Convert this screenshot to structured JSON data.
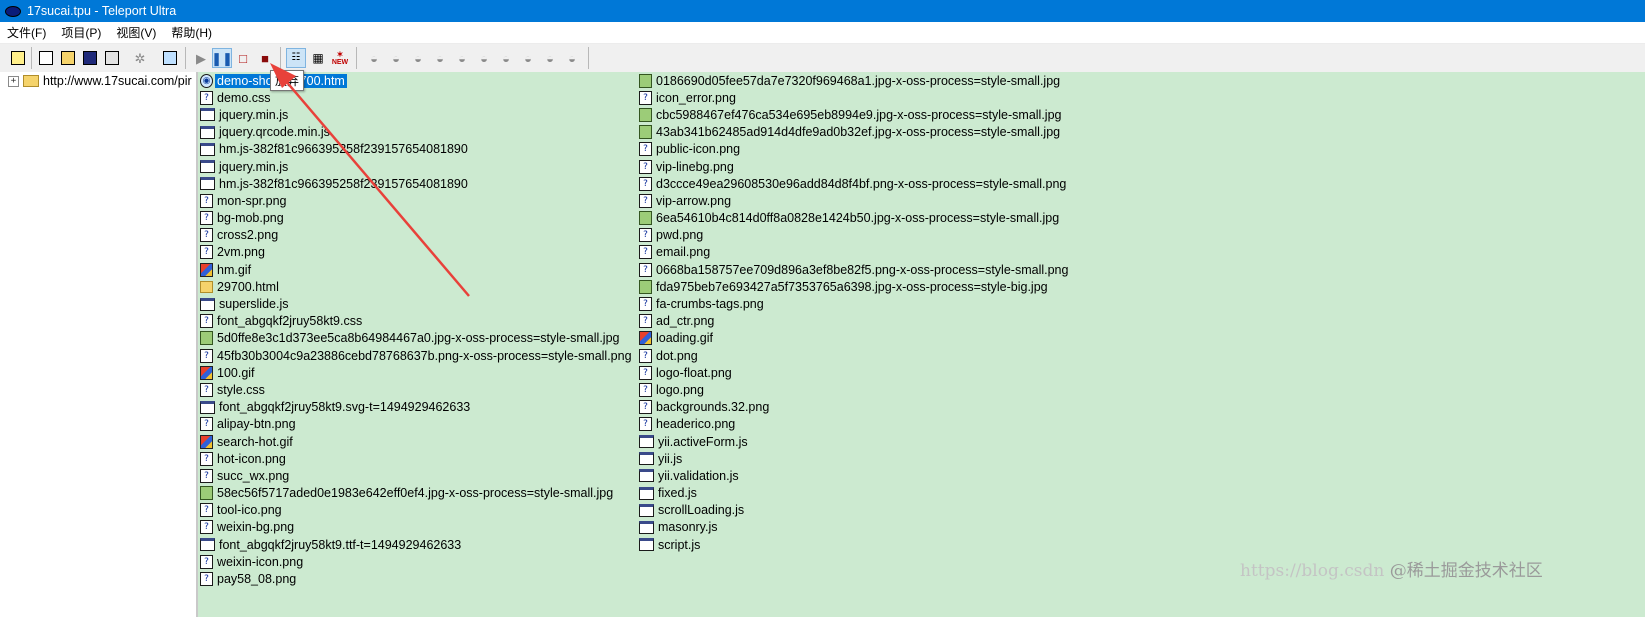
{
  "window": {
    "title": "17sucai.tpu - Teleport Ultra"
  },
  "menu": [
    "文件(F)",
    "项目(P)",
    "视图(V)",
    "帮助(H)"
  ],
  "toolbar": {
    "new_label": "NEW",
    "tooltip": "放弃"
  },
  "tree": {
    "root_label": "http://www.17sucai.com/pir"
  },
  "files": {
    "col1": [
      {
        "name": "demo-show-29700.htm",
        "icon": "html-page-icon"
      },
      {
        "name": "demo.css",
        "icon": "unknown-file-icon"
      },
      {
        "name": "jquery.min.js",
        "icon": "script-file-icon"
      },
      {
        "name": "jquery.qrcode.min.js",
        "icon": "script-file-icon"
      },
      {
        "name": "hm.js-382f81c966395258f239157654081890",
        "icon": "script-file-icon"
      },
      {
        "name": "jquery.min.js",
        "icon": "script-file-icon"
      },
      {
        "name": "hm.js-382f81c966395258f239157654081890",
        "icon": "script-file-icon"
      },
      {
        "name": "mon-spr.png",
        "icon": "unknown-file-icon"
      },
      {
        "name": "bg-mob.png",
        "icon": "unknown-file-icon"
      },
      {
        "name": "cross2.png",
        "icon": "unknown-file-icon"
      },
      {
        "name": "2vm.png",
        "icon": "unknown-file-icon"
      },
      {
        "name": "hm.gif",
        "icon": "gif-file-icon"
      },
      {
        "name": "29700.html",
        "icon": "folder-icon"
      },
      {
        "name": "superslide.js",
        "icon": "script-file-icon"
      },
      {
        "name": "font_abgqkf2jruy58kt9.css",
        "icon": "unknown-file-icon"
      },
      {
        "name": "5d0ffe8e3c1d373ee5ca8b64984467a0.jpg-x-oss-process=style-small.jpg",
        "icon": "image-file-icon"
      },
      {
        "name": "45fb30b3004c9a23886cebd78768637b.png-x-oss-process=style-small.png",
        "icon": "unknown-file-icon"
      },
      {
        "name": "100.gif",
        "icon": "gif-file-icon"
      },
      {
        "name": "style.css",
        "icon": "unknown-file-icon"
      },
      {
        "name": "font_abgqkf2jruy58kt9.svg-t=1494929462633",
        "icon": "script-file-icon"
      },
      {
        "name": "alipay-btn.png",
        "icon": "unknown-file-icon"
      },
      {
        "name": "search-hot.gif",
        "icon": "gif-file-icon"
      },
      {
        "name": "hot-icon.png",
        "icon": "unknown-file-icon"
      },
      {
        "name": "succ_wx.png",
        "icon": "unknown-file-icon"
      },
      {
        "name": "58ec56f5717aded0e1983e642eff0ef4.jpg-x-oss-process=style-small.jpg",
        "icon": "image-file-icon"
      },
      {
        "name": "tool-ico.png",
        "icon": "unknown-file-icon"
      },
      {
        "name": "weixin-bg.png",
        "icon": "unknown-file-icon"
      },
      {
        "name": "font_abgqkf2jruy58kt9.ttf-t=1494929462633",
        "icon": "script-file-icon"
      },
      {
        "name": "weixin-icon.png",
        "icon": "unknown-file-icon"
      },
      {
        "name": "pay58_08.png",
        "icon": "unknown-file-icon"
      }
    ],
    "col2": [
      {
        "name": "0186690d05fee57da7e7320f969468a1.jpg-x-oss-process=style-small.jpg",
        "icon": "image-file-icon"
      },
      {
        "name": "icon_error.png",
        "icon": "unknown-file-icon"
      },
      {
        "name": "cbc5988467ef476ca534e695eb8994e9.jpg-x-oss-process=style-small.jpg",
        "icon": "image-file-icon"
      },
      {
        "name": "43ab341b62485ad914d4dfe9ad0b32ef.jpg-x-oss-process=style-small.jpg",
        "icon": "image-file-icon"
      },
      {
        "name": "public-icon.png",
        "icon": "unknown-file-icon"
      },
      {
        "name": "vip-linebg.png",
        "icon": "unknown-file-icon"
      },
      {
        "name": "d3ccce49ea29608530e96add84d8f4bf.png-x-oss-process=style-small.png",
        "icon": "unknown-file-icon"
      },
      {
        "name": "vip-arrow.png",
        "icon": "unknown-file-icon"
      },
      {
        "name": "6ea54610b4c814d0ff8a0828e1424b50.jpg-x-oss-process=style-small.jpg",
        "icon": "image-file-icon"
      },
      {
        "name": "pwd.png",
        "icon": "unknown-file-icon"
      },
      {
        "name": "email.png",
        "icon": "unknown-file-icon"
      },
      {
        "name": "0668ba158757ee709d896a3ef8be82f5.png-x-oss-process=style-small.png",
        "icon": "unknown-file-icon"
      },
      {
        "name": "fda975beb7e693427a5f7353765a6398.jpg-x-oss-process=style-big.jpg",
        "icon": "image-file-icon"
      },
      {
        "name": "fa-crumbs-tags.png",
        "icon": "unknown-file-icon"
      },
      {
        "name": "ad_ctr.png",
        "icon": "unknown-file-icon"
      },
      {
        "name": "loading.gif",
        "icon": "gif-file-icon"
      },
      {
        "name": "dot.png",
        "icon": "unknown-file-icon"
      },
      {
        "name": "logo-float.png",
        "icon": "unknown-file-icon"
      },
      {
        "name": "logo.png",
        "icon": "unknown-file-icon"
      },
      {
        "name": "backgrounds.32.png",
        "icon": "unknown-file-icon"
      },
      {
        "name": "headerico.png",
        "icon": "unknown-file-icon"
      },
      {
        "name": "yii.activeForm.js",
        "icon": "script-file-icon"
      },
      {
        "name": "yii.js",
        "icon": "script-file-icon"
      },
      {
        "name": "yii.validation.js",
        "icon": "script-file-icon"
      },
      {
        "name": "fixed.js",
        "icon": "script-file-icon"
      },
      {
        "name": "scrollLoading.js",
        "icon": "script-file-icon"
      },
      {
        "name": "masonry.js",
        "icon": "script-file-icon"
      },
      {
        "name": "script.js",
        "icon": "script-file-icon"
      }
    ]
  },
  "watermark": {
    "url": "https://blog.csdn",
    "text": "@稀土掘金技术社区"
  },
  "colors": {
    "titlebar": "#0078d7",
    "file_pane_bg": "#ccead0",
    "selection": "#0078d7",
    "arrow": "#e8413a"
  }
}
